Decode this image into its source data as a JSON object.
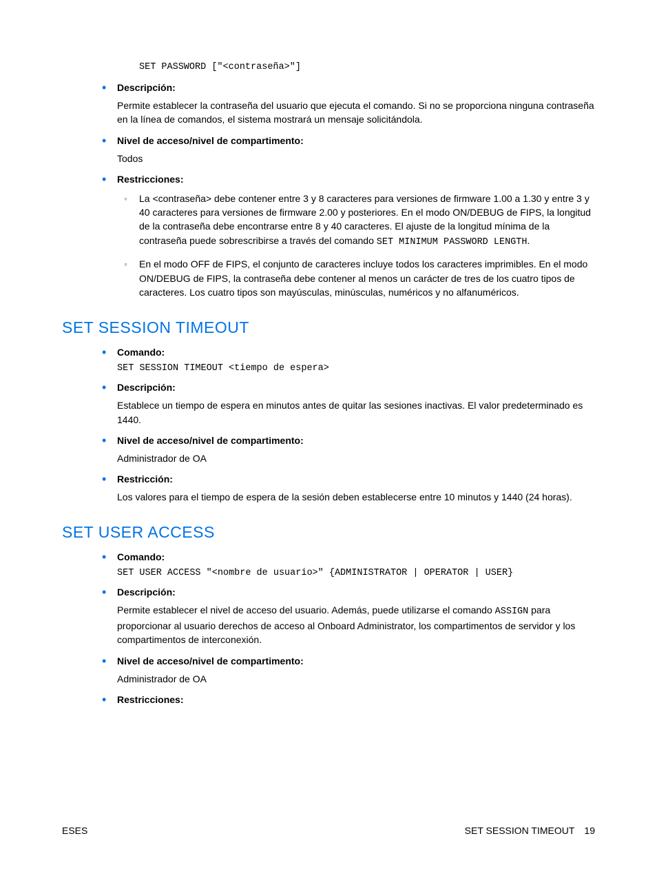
{
  "sections": {
    "setPassword": {
      "cmdSyntax": "SET PASSWORD [\"<contraseña>\"]",
      "descLabel": "Descripción:",
      "descText": "Permite establecer la contraseña del usuario que ejecuta el comando. Si no se proporciona ninguna contraseña en la línea de comandos, el sistema mostrará un mensaje solicitándola.",
      "accessLabel": "Nivel de acceso/nivel de compartimento:",
      "accessText": "Todos",
      "restrLabel": "Restricciones:",
      "r1a": "La <contraseña> debe contener entre 3 y 8 caracteres para versiones de firmware 1.00 a 1.30 y entre 3 y 40 caracteres para versiones de firmware 2.00 y posteriores. En el modo ON/DEBUG de FIPS, la longitud de la contraseña debe encontrarse entre 8 y 40 caracteres. El ajuste de la longitud mínima de la contraseña puede sobrescribirse a través del comando ",
      "r1code": "SET MINIMUM PASSWORD LENGTH",
      "r1b": ".",
      "r2": "En el modo OFF de FIPS, el conjunto de caracteres incluye todos los caracteres imprimibles. En el modo ON/DEBUG de FIPS, la contraseña debe contener al menos un carácter de tres de los cuatro tipos de caracteres. Los cuatro tipos son mayúsculas, minúsculas, numéricos y no alfanuméricos."
    },
    "setSessionTimeout": {
      "heading": "SET SESSION TIMEOUT",
      "cmdLabel": "Comando:",
      "cmdSyntax": "SET SESSION TIMEOUT <tiempo de espera>",
      "descLabel": "Descripción:",
      "descText": "Establece un tiempo de espera en minutos antes de quitar las sesiones inactivas. El valor predeterminado es 1440.",
      "accessLabel": "Nivel de acceso/nivel de compartimento:",
      "accessText": "Administrador de OA",
      "restrLabel": "Restricción:",
      "restrText": "Los valores para el tiempo de espera de la sesión deben establecerse entre 10 minutos y 1440 (24 horas)."
    },
    "setUserAccess": {
      "heading": "SET USER ACCESS",
      "cmdLabel": "Comando:",
      "cmdSyntax": "SET USER ACCESS \"<nombre de usuario>\" {ADMINISTRATOR | OPERATOR | USER}",
      "descLabel": "Descripción:",
      "descA": "Permite establecer el nivel de acceso del usuario. Además, puede utilizarse el comando ",
      "descCode": "ASSIGN",
      "descB": " para proporcionar al usuario derechos de acceso al Onboard Administrator, los compartimentos de servidor y los compartimentos de interconexión.",
      "accessLabel": "Nivel de acceso/nivel de compartimento:",
      "accessText": "Administrador de OA",
      "restrLabel": "Restricciones:"
    }
  },
  "footer": {
    "left": "ESES",
    "rightLabel": "SET SESSION TIMEOUT",
    "pageNum": "19"
  }
}
